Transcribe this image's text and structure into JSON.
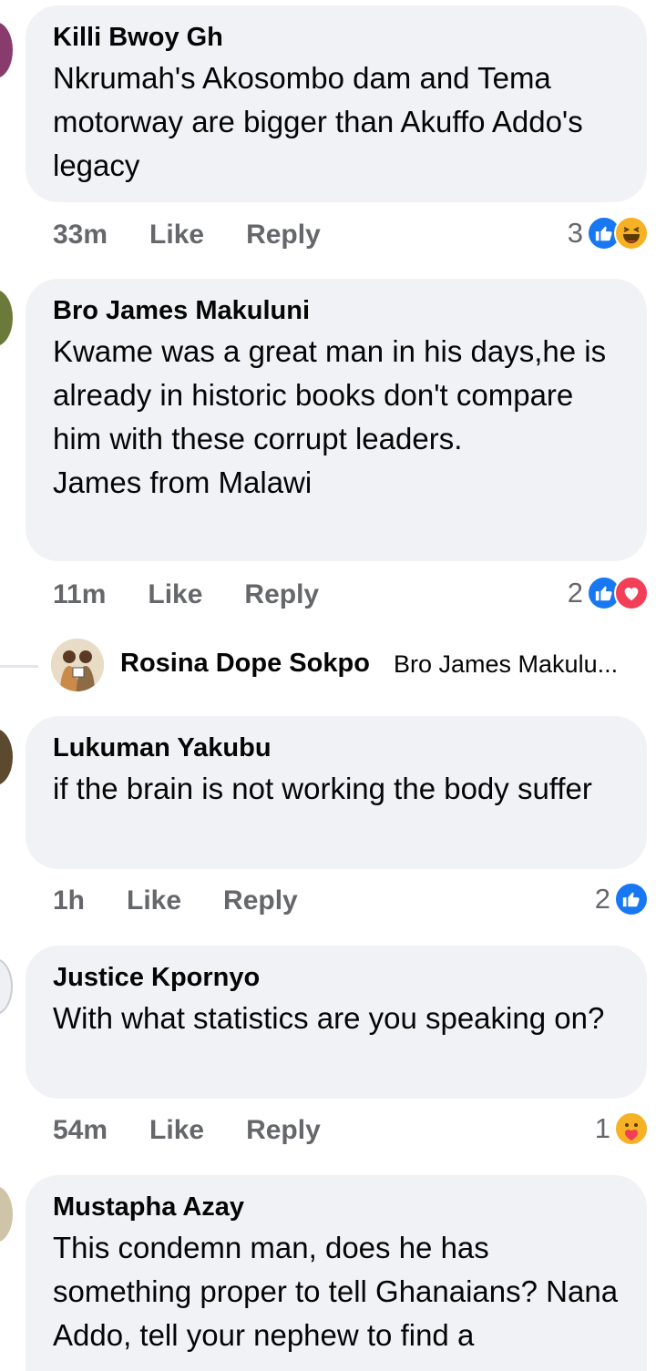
{
  "comments": [
    {
      "author": "Killi Bwoy Gh",
      "text": "Nkrumah's Akosombo dam and Tema motorway are bigger than Akuffo Addo's legacy",
      "time": "33m",
      "like_label": "Like",
      "reply_label": "Reply",
      "reaction_count": "3",
      "reactions": [
        "like-icon",
        "haha-icon"
      ]
    },
    {
      "author": "Bro James Makuluni",
      "text": "Kwame was a great man in his days,he is already in historic books don't compare him with these corrupt leaders.\nJames from Malawi",
      "time": "11m",
      "like_label": "Like",
      "reply_label": "Reply",
      "reaction_count": "2",
      "reactions": [
        "like-icon",
        "love-icon"
      ]
    },
    {
      "author": "Lukuman Yakubu",
      "text": "if the brain is not working the body suffer",
      "time": "1h",
      "like_label": "Like",
      "reply_label": "Reply",
      "reaction_count": "2",
      "reactions": [
        "like-icon"
      ]
    },
    {
      "author": "Justice Kpornyo",
      "text": "With what statistics are you speaking on?",
      "time": "54m",
      "like_label": "Like",
      "reply_label": "Reply",
      "reaction_count": "1",
      "reactions": [
        "care-icon"
      ]
    },
    {
      "author": "Mustapha Azay",
      "text": "This condemn man, does he has something proper to tell Ghanaians? Nana Addo, tell your nephew to find a"
    }
  ],
  "reply_preview": {
    "author": "Rosina Dope Sokpo",
    "snippet": "Bro James Makulu..."
  },
  "colors": {
    "bubble": "#f0f2f5",
    "meta_text": "#65676b",
    "like_blue": "#1877f2",
    "love_red": "#f33e58",
    "emoji_yellow": "#f7b125"
  }
}
